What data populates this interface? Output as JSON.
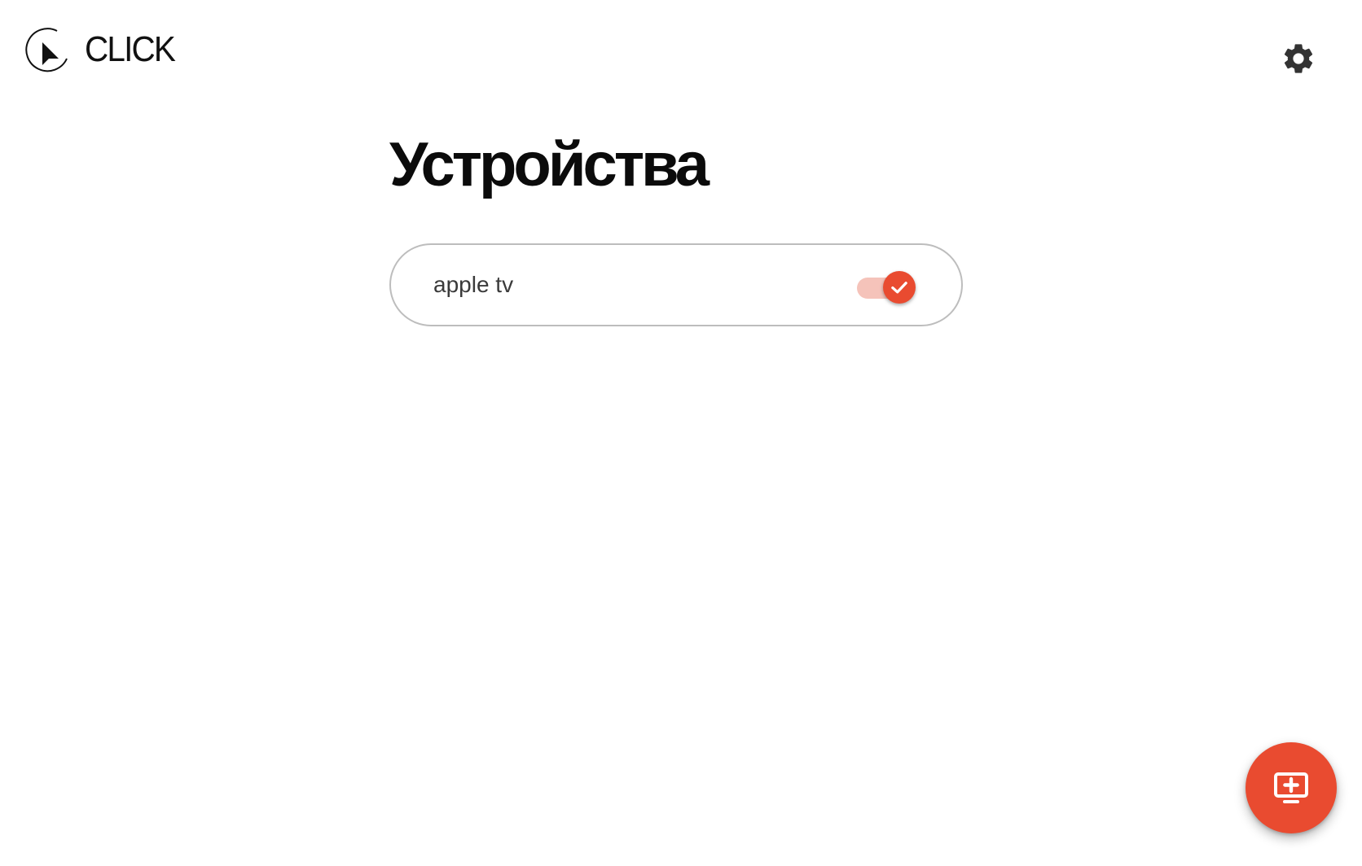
{
  "app": {
    "brand_name": "CLICK",
    "logo_icon": "play-cursor-logo",
    "settings_icon": "gear-icon"
  },
  "page": {
    "title": "Устройства"
  },
  "devices": [
    {
      "name": "apple tv",
      "enabled": true
    }
  ],
  "fab": {
    "icon": "add-to-screen-icon"
  },
  "colors": {
    "accent": "#e94b30",
    "accent_light": "#f5c3ba",
    "text": "#0b0b0b",
    "border": "#bdbdbd",
    "icon": "#333333"
  }
}
